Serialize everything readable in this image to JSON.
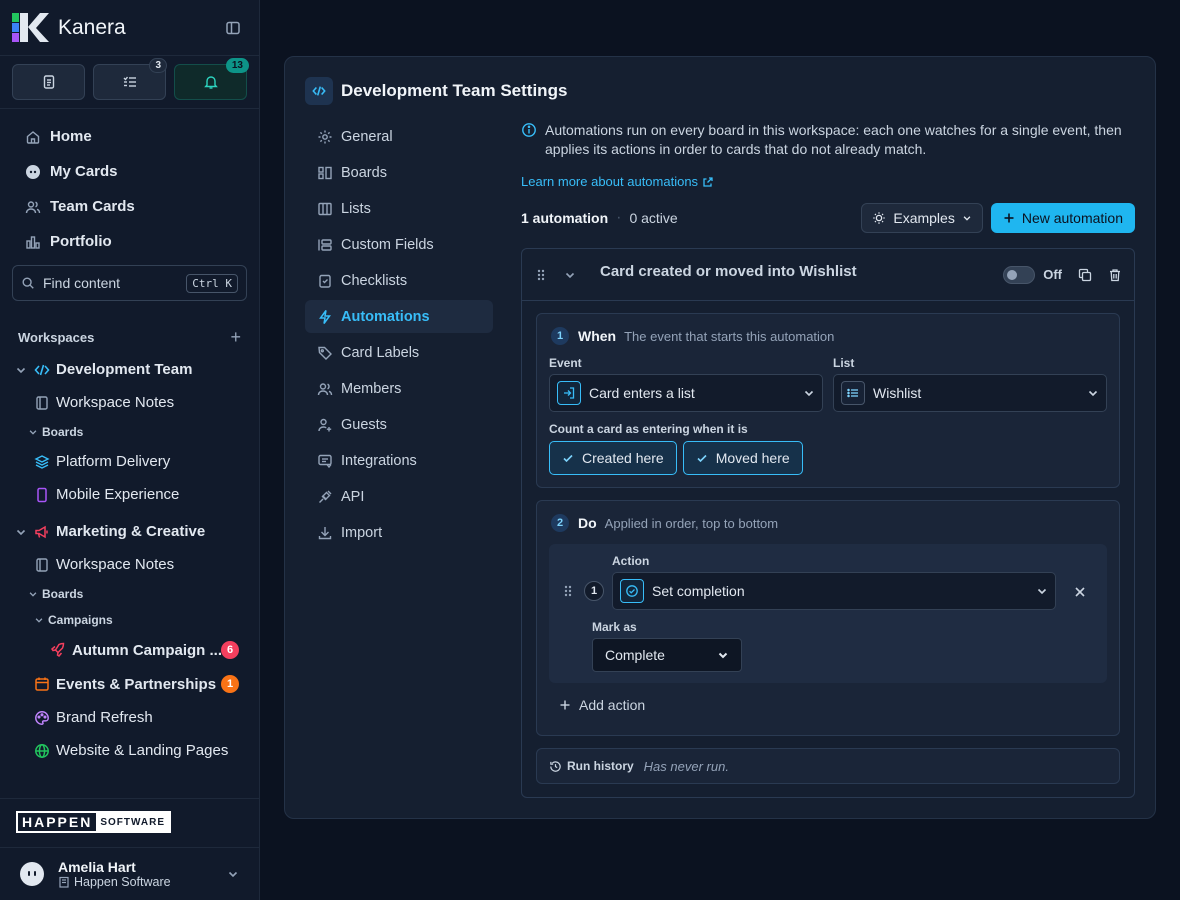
{
  "app": {
    "name": "Kanera",
    "brand_colors": [
      "#22c55e",
      "#3b82f6",
      "#a855f7",
      "#e2e8f0"
    ]
  },
  "quick": {
    "notifications_badge": "3",
    "alerts_badge": "13"
  },
  "nav": {
    "home": "Home",
    "my_cards": "My Cards",
    "team_cards": "Team Cards",
    "portfolio": "Portfolio"
  },
  "find": {
    "placeholder": "Find content",
    "shortcut": "Ctrl K"
  },
  "workspaces": {
    "heading": "Workspaces",
    "dev": {
      "name": "Development Team",
      "notes": "Workspace Notes",
      "boards_label": "Boards",
      "boards": [
        "Platform Delivery",
        "Mobile Experience"
      ]
    },
    "marketing": {
      "name": "Marketing & Creative",
      "notes": "Workspace Notes",
      "boards_label": "Boards",
      "folder": "Campaigns",
      "autumn": "Autumn Campaign ...",
      "autumn_count": "6",
      "events": "Events & Partnerships",
      "events_count": "1",
      "brand": "Brand Refresh",
      "website": "Website & Landing Pages"
    }
  },
  "org_logo": {
    "word": "HAPPEN",
    "tag": "SOFTWARE"
  },
  "user": {
    "name": "Amelia Hart",
    "org": "Happen Software"
  },
  "panel": {
    "title": "Development Team Settings",
    "menu": [
      "General",
      "Boards",
      "Lists",
      "Custom Fields",
      "Checklists",
      "Automations",
      "Card Labels",
      "Members",
      "Guests",
      "Integrations",
      "API",
      "Import"
    ],
    "active": "Automations"
  },
  "automations": {
    "info": "Automations run on every board in this workspace: each one watches for a single event, then applies its actions in order to cards that do not already match.",
    "learn_more": "Learn more about automations",
    "count": "1 automation",
    "active": "0 active",
    "examples": "Examples",
    "new": "New automation",
    "card": {
      "title": "Card created or moved into Wishlist",
      "toggle": "Off",
      "when": {
        "num": "1",
        "title": "When",
        "desc": "The event that starts this automation",
        "event_label": "Event",
        "event_value": "Card enters a list",
        "list_label": "List",
        "list_value": "Wishlist",
        "count_label": "Count a card as entering when it is",
        "chips": [
          "Created here",
          "Moved here"
        ]
      },
      "do": {
        "num": "2",
        "title": "Do",
        "desc": "Applied in order, top to bottom",
        "action_num": "1",
        "action_label": "Action",
        "action_value": "Set completion",
        "mark_label": "Mark as",
        "mark_value": "Complete",
        "add": "Add action"
      },
      "history_label": "Run history",
      "history_value": "Has never run."
    }
  }
}
